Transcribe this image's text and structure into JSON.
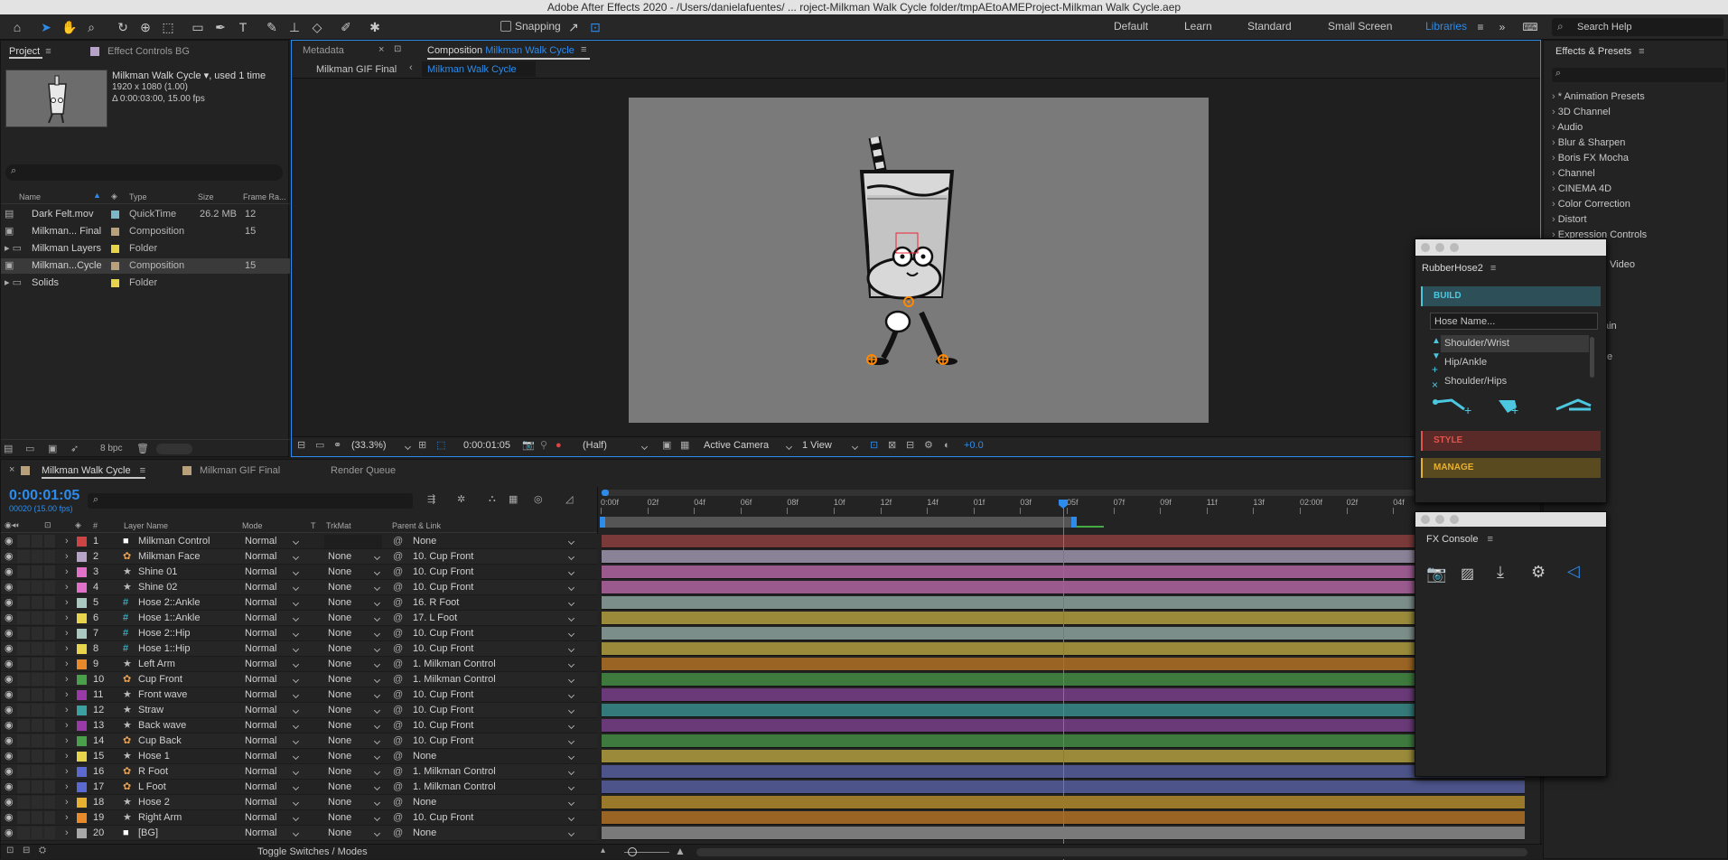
{
  "window": {
    "title": "Adobe After Effects 2020 - /Users/danielafuentes/ ... roject-Milkman Walk Cycle folder/tmpAEtoAMEProject-Milkman Walk Cycle.aep"
  },
  "toolbar": {
    "snapping": "Snapping",
    "workspaces": [
      "Default",
      "Learn",
      "Standard",
      "Small Screen",
      "Libraries"
    ],
    "search_help": "Search Help"
  },
  "project": {
    "tab": "Project",
    "tab2": "Effect Controls BG",
    "item_name": "Milkman Walk Cycle",
    "item_used": ", used 1 time",
    "item_size": "1920 x 1080 (1.00)",
    "item_duration": "Δ 0:00:03:00, 15.00 fps",
    "columns": [
      "Name",
      "Type",
      "Size",
      "Frame Ra..."
    ],
    "items": [
      {
        "name": "Dark Felt.mov",
        "type": "QuickTime",
        "size": "26.2 MB",
        "fps": "12",
        "color": "#7ab8c8"
      },
      {
        "name": "Milkman... Final",
        "type": "Composition",
        "size": "",
        "fps": "15",
        "color": "#b7a07a"
      },
      {
        "name": "Milkman Layers",
        "type": "Folder",
        "size": "",
        "fps": "",
        "color": "#e8d44a"
      },
      {
        "name": "Milkman...Cycle",
        "type": "Composition",
        "size": "",
        "fps": "15",
        "color": "#b7a07a"
      },
      {
        "name": "Solids",
        "type": "Folder",
        "size": "",
        "fps": "",
        "color": "#e8d44a"
      }
    ],
    "bpc": "8 bpc"
  },
  "viewer": {
    "tab_metadata": "Metadata",
    "tab_comp": "Composition",
    "tab_comp_name": "Milkman Walk Cycle",
    "crumb1": "Milkman GIF Final",
    "crumb2": "Milkman Walk Cycle",
    "zoom": "(33.3%)",
    "timecode": "0:00:01:05",
    "resolution": "(Half)",
    "camera": "Active Camera",
    "views": "1 View",
    "exposure": "+0.0"
  },
  "timeline": {
    "tab_active": "Milkman Walk Cycle",
    "tab2": "Milkman GIF Final",
    "tab3": "Render Queue",
    "timecode": "0:00:01:05",
    "frames": "00020 (15.00 fps)",
    "headers": {
      "num": "#",
      "layer": "Layer Name",
      "mode": "Mode",
      "t": "T",
      "trkmat": "TrkMat",
      "parent": "Parent & Link"
    },
    "ruler": [
      "0:00f",
      "02f",
      "04f",
      "06f",
      "08f",
      "10f",
      "12f",
      "14f",
      "01f",
      "03f",
      "05f",
      "07f",
      "09f",
      "11f",
      "13f",
      "02:00f",
      "02f",
      "04f"
    ],
    "toggle": "Toggle Switches / Modes",
    "layers": [
      {
        "n": "1",
        "name": "Milkman Control",
        "type": "solid",
        "mode": "Normal",
        "trk": "",
        "parent": "None",
        "lc": "#cc4444",
        "bar": "#7a3a3a"
      },
      {
        "n": "2",
        "name": "Milkman Face",
        "type": "ai",
        "mode": "Normal",
        "trk": "None",
        "parent": "10. Cup Front",
        "lc": "#b8a3c8",
        "bar": "#8a8296"
      },
      {
        "n": "3",
        "name": "Shine 01",
        "type": "star",
        "mode": "Normal",
        "trk": "None",
        "parent": "10. Cup Front",
        "lc": "#e070c8",
        "bar": "#9a5a8e"
      },
      {
        "n": "4",
        "name": "Shine 02",
        "type": "star",
        "mode": "Normal",
        "trk": "None",
        "parent": "10. Cup Front",
        "lc": "#e070c8",
        "bar": "#9a5a8e"
      },
      {
        "n": "5",
        "name": "Hose 2::Ankle",
        "type": "null",
        "mode": "Normal",
        "trk": "None",
        "parent": "16. R Foot",
        "lc": "#a8c8c0",
        "bar": "#7c8e8a"
      },
      {
        "n": "6",
        "name": "Hose 1::Ankle",
        "type": "null",
        "mode": "Normal",
        "trk": "None",
        "parent": "17. L Foot",
        "lc": "#e8d44a",
        "bar": "#9a8a3a"
      },
      {
        "n": "7",
        "name": "Hose 2::Hip",
        "type": "null",
        "mode": "Normal",
        "trk": "None",
        "parent": "10. Cup Front",
        "lc": "#a8c8c0",
        "bar": "#7c8e8a"
      },
      {
        "n": "8",
        "name": "Hose 1::Hip",
        "type": "null",
        "mode": "Normal",
        "trk": "None",
        "parent": "10. Cup Front",
        "lc": "#e8d44a",
        "bar": "#9a8a3a"
      },
      {
        "n": "9",
        "name": "Left Arm",
        "type": "star",
        "mode": "Normal",
        "trk": "None",
        "parent": "1. Milkman Control",
        "lc": "#e88a2a",
        "bar": "#9a6424"
      },
      {
        "n": "10",
        "name": "Cup Front",
        "type": "ai",
        "mode": "Normal",
        "trk": "None",
        "parent": "1. Milkman Control",
        "lc": "#4aa04a",
        "bar": "#3e7a3e"
      },
      {
        "n": "11",
        "name": "Front wave",
        "type": "star",
        "mode": "Normal",
        "trk": "None",
        "parent": "10. Cup Front",
        "lc": "#9a3aa8",
        "bar": "#6a3a78"
      },
      {
        "n": "12",
        "name": "Straw",
        "type": "star",
        "mode": "Normal",
        "trk": "None",
        "parent": "10. Cup Front",
        "lc": "#3aa0a0",
        "bar": "#347a7a"
      },
      {
        "n": "13",
        "name": "Back wave",
        "type": "star",
        "mode": "Normal",
        "trk": "None",
        "parent": "10. Cup Front",
        "lc": "#9a3aa8",
        "bar": "#6a3a78"
      },
      {
        "n": "14",
        "name": "Cup Back",
        "type": "ai",
        "mode": "Normal",
        "trk": "None",
        "parent": "10. Cup Front",
        "lc": "#4aa04a",
        "bar": "#3e7a3e"
      },
      {
        "n": "15",
        "name": "Hose 1",
        "type": "star",
        "mode": "Normal",
        "trk": "None",
        "parent": "None",
        "lc": "#e8d44a",
        "bar": "#9a8a3a"
      },
      {
        "n": "16",
        "name": "R Foot",
        "type": "ai",
        "mode": "Normal",
        "trk": "None",
        "parent": "1. Milkman Control",
        "lc": "#5a6ad0",
        "bar": "#4c548a"
      },
      {
        "n": "17",
        "name": "L Foot",
        "type": "ai",
        "mode": "Normal",
        "trk": "None",
        "parent": "1. Milkman Control",
        "lc": "#5a6ad0",
        "bar": "#4c548a"
      },
      {
        "n": "18",
        "name": "Hose 2",
        "type": "star",
        "mode": "Normal",
        "trk": "None",
        "parent": "None",
        "lc": "#e8b030",
        "bar": "#9a7a2a"
      },
      {
        "n": "19",
        "name": "Right Arm",
        "type": "star",
        "mode": "Normal",
        "trk": "None",
        "parent": "10. Cup Front",
        "lc": "#e88a2a",
        "bar": "#9a6424"
      },
      {
        "n": "20",
        "name": "[BG]",
        "type": "solid",
        "mode": "Normal",
        "trk": "None",
        "parent": "None",
        "lc": "#a8a8a8",
        "bar": "#7a7a7a"
      }
    ]
  },
  "effects": {
    "title": "Effects & Presets",
    "items": [
      "* Animation Presets",
      "3D Channel",
      "Audio",
      "Blur & Sharpen",
      "Boris FX Mocha",
      "Channel",
      "CINEMA 4D",
      "Color Correction",
      "Distort",
      "Expression Controls"
    ],
    "partial": [
      "Video",
      "ain",
      "e"
    ]
  },
  "rubberhose": {
    "title": "RubberHose2",
    "build": "BUILD",
    "placeholder": "Hose Name...",
    "options": [
      "Shoulder/Wrist",
      "Hip/Ankle",
      "Shoulder/Hips"
    ],
    "style": "STYLE",
    "manage": "MANAGE"
  },
  "fxconsole": {
    "title": "FX Console"
  }
}
